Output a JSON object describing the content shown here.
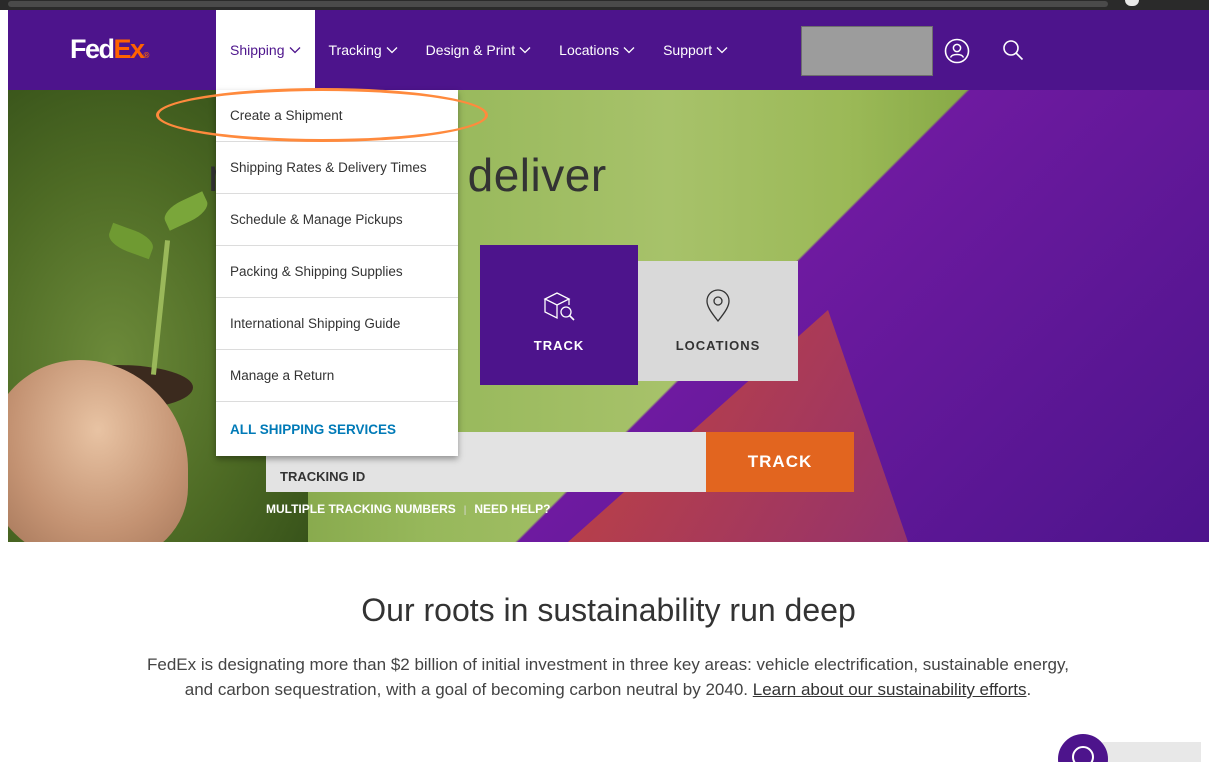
{
  "header": {
    "logo": {
      "fed": "Fed",
      "ex": "Ex",
      "reg": "®"
    },
    "nav": [
      {
        "label": "Shipping",
        "active": true
      },
      {
        "label": "Tracking",
        "active": false
      },
      {
        "label": "Design & Print",
        "active": false
      },
      {
        "label": "Locations",
        "active": false
      },
      {
        "label": "Support",
        "active": false
      }
    ],
    "icons": {
      "account": "user-circle-icon",
      "search": "search-icon"
    }
  },
  "shipping_menu": {
    "items": [
      "Create a Shipment",
      "Shipping Rates & Delivery Times",
      "Schedule & Manage Pickups",
      "Packing & Shipping Supplies",
      "International Shipping Guide",
      "Manage a Return"
    ],
    "all_services": "ALL SHIPPING SERVICES"
  },
  "hero": {
    "title": "nage, track, deliver",
    "tiles": {
      "track": {
        "label": "TRACK",
        "icon": "box-magnifier-icon"
      },
      "locations": {
        "label": "LOCATIONS",
        "icon": "map-pin-icon"
      }
    },
    "tracking": {
      "placeholder": "TRACKING ID",
      "button": "TRACK",
      "links": {
        "multiple": "MULTIPLE TRACKING NUMBERS",
        "separator": "|",
        "help": "NEED HELP?"
      }
    }
  },
  "sustainability": {
    "title": "Our roots in sustainability run deep",
    "body": "FedEx is designating more than $2 billion of initial investment in three key areas: vehicle electrification, sustainable energy, and carbon sequestration, with a goal of becoming carbon neutral by 2040. ",
    "link": "Learn about our sustainability efforts",
    "after_link": "."
  },
  "colors": {
    "fedex_purple": "#4d148c",
    "fedex_orange": "#ff6200",
    "track_button": "#e2651f",
    "link_blue": "#007ab7",
    "highlight": "#ff8a3d"
  }
}
